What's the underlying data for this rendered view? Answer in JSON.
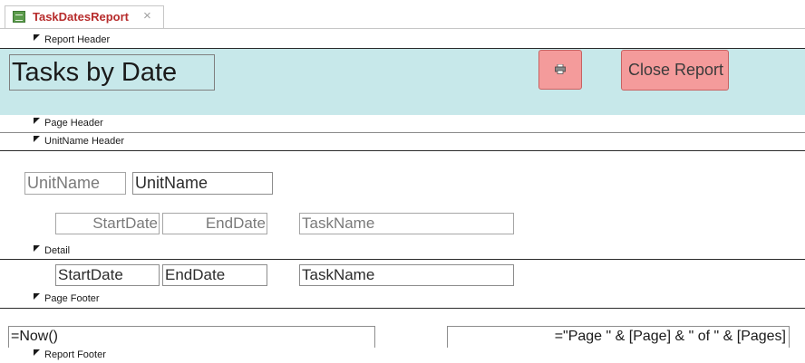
{
  "tab": {
    "title": "TaskDatesReport",
    "close_glyph": "×"
  },
  "sections": {
    "report_header": "Report Header",
    "page_header": "Page Header",
    "unitname_header": "UnitName Header",
    "detail": "Detail",
    "page_footer": "Page Footer",
    "report_footer": "Report Footer"
  },
  "report_header": {
    "title": "Tasks by Date",
    "print_button_icon": "printer-icon",
    "close_button_label": "Close Report",
    "band_color": "#c7e8ea",
    "button_color": "#f49b9b"
  },
  "unitname_header": {
    "unitname_label": "UnitName",
    "unitname_field": "UnitName",
    "startdate_label": "StartDate",
    "enddate_label": "EndDate",
    "taskname_label": "TaskName"
  },
  "detail": {
    "startdate_field": "StartDate",
    "enddate_field": "EndDate",
    "taskname_field": "TaskName"
  },
  "page_footer": {
    "now_field": "=Now()",
    "page_field": "=\"Page \" & [Page] & \" of \" & [Pages]"
  },
  "tab_accent": "#b72c2c"
}
